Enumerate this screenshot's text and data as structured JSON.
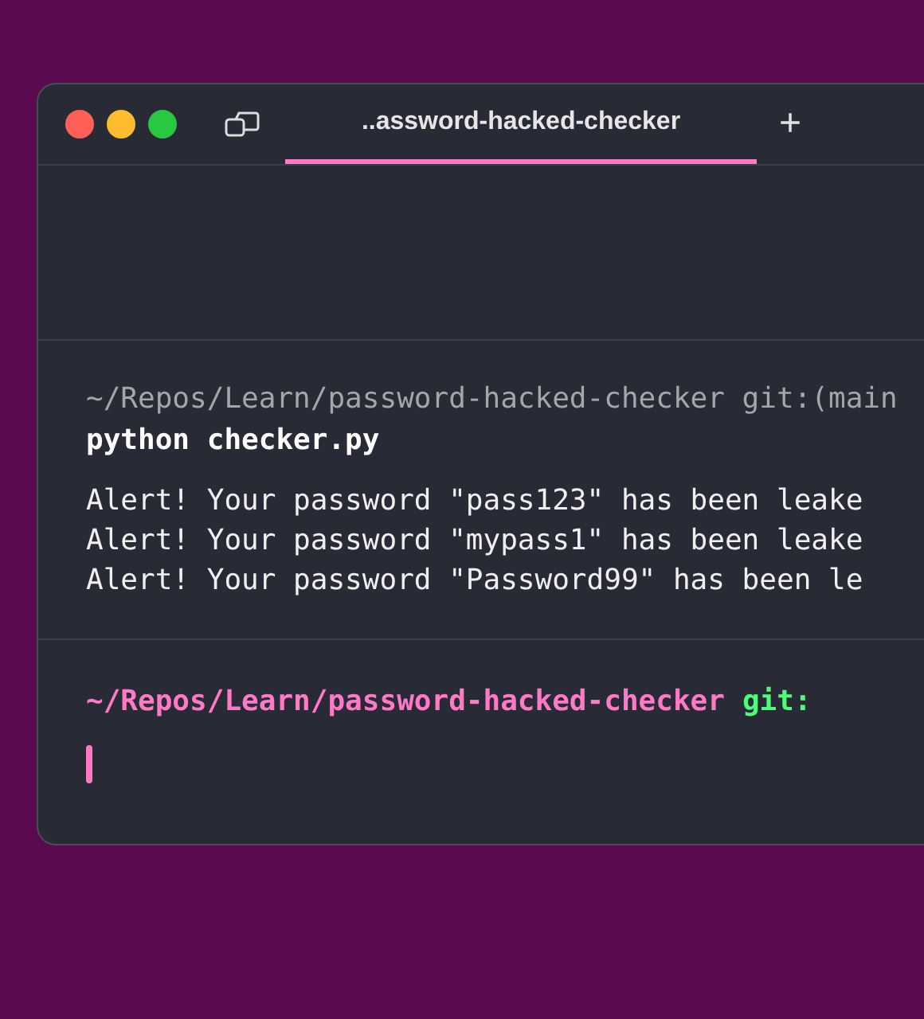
{
  "window": {
    "tab": {
      "title": "..assword-hacked-checker",
      "selected": true
    },
    "new_tab": "+"
  },
  "blocks": [
    {
      "prompt_path": "~/Repos/Learn/password-hacked-checker",
      "prompt_git": "git:(main",
      "command": "python checker.py",
      "output": [
        "Alert! Your password \"pass123\" has been leake",
        "Alert! Your password \"mypass1\" has been leake",
        "Alert! Your password \"Password99\" has been le"
      ]
    }
  ],
  "active_prompt": {
    "path": "~/Repos/Learn/password-hacked-checker",
    "git": "git:"
  }
}
